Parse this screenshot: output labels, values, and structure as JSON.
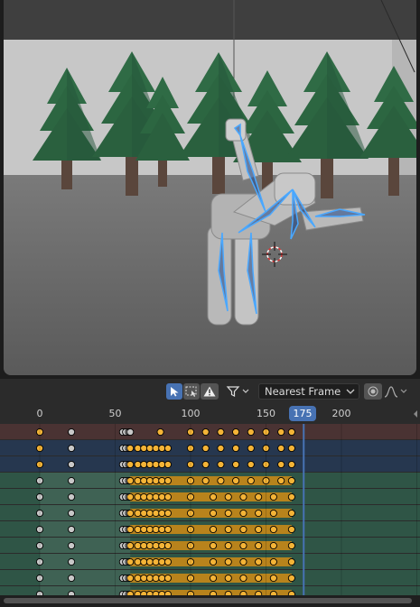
{
  "viewport": {
    "scene": "3D viewport: low-poly grey character with blue armature bones bending forward, pine trees, 3D cursor"
  },
  "dopesheet": {
    "header": {
      "select_tool_icon": "cursor-arrow-icon",
      "box_select_icon": "box-select-icon",
      "warning_icon": "warning-triangle-icon",
      "filter_icon": "funnel-icon",
      "snap_mode": "Nearest Frame",
      "proportional_icon": "proportional-edit-icon",
      "falloff_icon": "falloff-curve-icon"
    },
    "ruler": {
      "ticks": [
        "0",
        "50",
        "100",
        "150",
        "200"
      ],
      "tick_frames": [
        0,
        50,
        100,
        150,
        200
      ],
      "current_frame": "175",
      "current_frame_value": 175
    },
    "colors": {
      "summary_row": "#4a3333",
      "object_row": "#26374f",
      "bone_row": "#2f5546",
      "keyframe_selected": "#f4b437",
      "keyframe_unselected": "#c8c8c8",
      "hold_bar": "#b8831c",
      "current_frame_line": "#4772b3"
    },
    "rows": [
      {
        "type": "summary",
        "keys_unsel": [
          21
        ],
        "keys_sel": [
          0,
          80,
          100,
          110,
          120,
          130,
          140,
          150,
          160,
          167
        ],
        "grey_mid": [
          55,
          57,
          59,
          60
        ]
      },
      {
        "type": "object",
        "keys_unsel": [
          21,
          55,
          57,
          59
        ],
        "keys_sel": [
          0,
          60,
          65,
          69,
          73,
          77,
          81,
          85,
          100,
          110,
          120,
          130,
          140,
          150,
          160,
          167
        ]
      },
      {
        "type": "object",
        "keys_unsel": [
          21,
          55,
          57,
          59
        ],
        "keys_sel": [
          0,
          60,
          65,
          69,
          73,
          77,
          81,
          85,
          100,
          110,
          120,
          130,
          140,
          150,
          160,
          167
        ]
      },
      {
        "type": "bone",
        "keys_unsel": [
          0,
          21,
          55,
          57,
          59
        ],
        "keys_sel": [
          60,
          65,
          69,
          73,
          77,
          81,
          85,
          100,
          110,
          120,
          130,
          140,
          150,
          160,
          167
        ],
        "hold": [
          60,
          167
        ]
      },
      {
        "type": "bone",
        "keys_unsel": [
          0,
          21,
          55,
          57,
          59
        ],
        "keys_sel": [
          60,
          65,
          69,
          73,
          77,
          81,
          85,
          100,
          115,
          125,
          135,
          145,
          155,
          167
        ],
        "hold": [
          60,
          167
        ]
      },
      {
        "type": "bone",
        "keys_unsel": [
          0,
          21,
          55,
          57,
          59
        ],
        "keys_sel": [
          60,
          65,
          69,
          73,
          77,
          81,
          85,
          100,
          115,
          125,
          135,
          145,
          155,
          167
        ],
        "hold": [
          60,
          167
        ]
      },
      {
        "type": "bone",
        "keys_unsel": [
          0,
          21,
          55,
          57,
          59
        ],
        "keys_sel": [
          60,
          65,
          69,
          73,
          77,
          81,
          85,
          100,
          115,
          125,
          135,
          145,
          155,
          167
        ],
        "hold": [
          60,
          167
        ]
      },
      {
        "type": "bone",
        "keys_unsel": [
          0,
          21,
          55,
          57,
          59
        ],
        "keys_sel": [
          60,
          65,
          69,
          73,
          77,
          81,
          85,
          100,
          115,
          125,
          135,
          145,
          155,
          167
        ],
        "hold": [
          60,
          167
        ]
      },
      {
        "type": "bone",
        "keys_unsel": [
          0,
          21,
          55,
          57,
          59
        ],
        "keys_sel": [
          60,
          65,
          69,
          73,
          77,
          81,
          85,
          100,
          115,
          125,
          135,
          145,
          155,
          167
        ],
        "hold": [
          60,
          167
        ]
      },
      {
        "type": "bone",
        "keys_unsel": [
          0,
          21,
          55,
          57,
          59
        ],
        "keys_sel": [
          60,
          65,
          69,
          73,
          77,
          81,
          85,
          100,
          115,
          125,
          135,
          145,
          155,
          167
        ],
        "hold": [
          60,
          167
        ]
      },
      {
        "type": "bone",
        "keys_unsel": [
          0,
          21,
          55,
          57,
          59
        ],
        "keys_sel": [
          60,
          65,
          69,
          73,
          77,
          81,
          85,
          100,
          115,
          125,
          135,
          145,
          155,
          167
        ],
        "hold": [
          60,
          167
        ]
      }
    ]
  }
}
